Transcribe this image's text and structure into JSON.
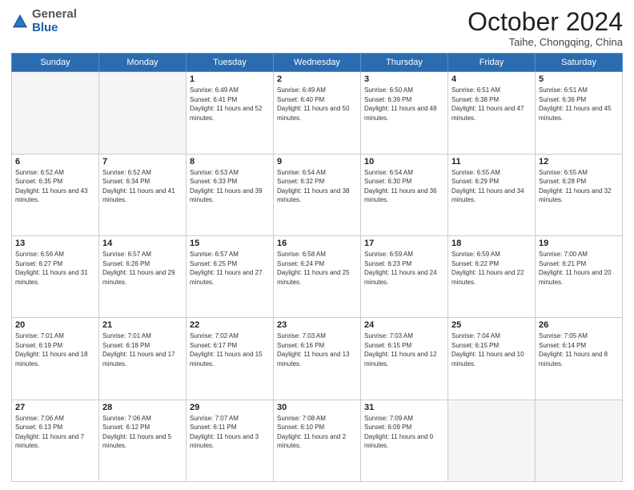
{
  "header": {
    "logo_general": "General",
    "logo_blue": "Blue",
    "month_title": "October 2024",
    "subtitle": "Taihe, Chongqing, China"
  },
  "weekdays": [
    "Sunday",
    "Monday",
    "Tuesday",
    "Wednesday",
    "Thursday",
    "Friday",
    "Saturday"
  ],
  "weeks": [
    [
      {
        "day": "",
        "sunrise": "",
        "sunset": "",
        "daylight": "",
        "empty": true
      },
      {
        "day": "",
        "sunrise": "",
        "sunset": "",
        "daylight": "",
        "empty": true
      },
      {
        "day": "1",
        "sunrise": "Sunrise: 6:49 AM",
        "sunset": "Sunset: 6:41 PM",
        "daylight": "Daylight: 11 hours and 52 minutes.",
        "empty": false
      },
      {
        "day": "2",
        "sunrise": "Sunrise: 6:49 AM",
        "sunset": "Sunset: 6:40 PM",
        "daylight": "Daylight: 11 hours and 50 minutes.",
        "empty": false
      },
      {
        "day": "3",
        "sunrise": "Sunrise: 6:50 AM",
        "sunset": "Sunset: 6:39 PM",
        "daylight": "Daylight: 11 hours and 48 minutes.",
        "empty": false
      },
      {
        "day": "4",
        "sunrise": "Sunrise: 6:51 AM",
        "sunset": "Sunset: 6:38 PM",
        "daylight": "Daylight: 11 hours and 47 minutes.",
        "empty": false
      },
      {
        "day": "5",
        "sunrise": "Sunrise: 6:51 AM",
        "sunset": "Sunset: 6:36 PM",
        "daylight": "Daylight: 11 hours and 45 minutes.",
        "empty": false
      }
    ],
    [
      {
        "day": "6",
        "sunrise": "Sunrise: 6:52 AM",
        "sunset": "Sunset: 6:35 PM",
        "daylight": "Daylight: 11 hours and 43 minutes.",
        "empty": false
      },
      {
        "day": "7",
        "sunrise": "Sunrise: 6:52 AM",
        "sunset": "Sunset: 6:34 PM",
        "daylight": "Daylight: 11 hours and 41 minutes.",
        "empty": false
      },
      {
        "day": "8",
        "sunrise": "Sunrise: 6:53 AM",
        "sunset": "Sunset: 6:33 PM",
        "daylight": "Daylight: 11 hours and 39 minutes.",
        "empty": false
      },
      {
        "day": "9",
        "sunrise": "Sunrise: 6:54 AM",
        "sunset": "Sunset: 6:32 PM",
        "daylight": "Daylight: 11 hours and 38 minutes.",
        "empty": false
      },
      {
        "day": "10",
        "sunrise": "Sunrise: 6:54 AM",
        "sunset": "Sunset: 6:30 PM",
        "daylight": "Daylight: 11 hours and 36 minutes.",
        "empty": false
      },
      {
        "day": "11",
        "sunrise": "Sunrise: 6:55 AM",
        "sunset": "Sunset: 6:29 PM",
        "daylight": "Daylight: 11 hours and 34 minutes.",
        "empty": false
      },
      {
        "day": "12",
        "sunrise": "Sunrise: 6:55 AM",
        "sunset": "Sunset: 6:28 PM",
        "daylight": "Daylight: 11 hours and 32 minutes.",
        "empty": false
      }
    ],
    [
      {
        "day": "13",
        "sunrise": "Sunrise: 6:56 AM",
        "sunset": "Sunset: 6:27 PM",
        "daylight": "Daylight: 11 hours and 31 minutes.",
        "empty": false
      },
      {
        "day": "14",
        "sunrise": "Sunrise: 6:57 AM",
        "sunset": "Sunset: 6:26 PM",
        "daylight": "Daylight: 11 hours and 29 minutes.",
        "empty": false
      },
      {
        "day": "15",
        "sunrise": "Sunrise: 6:57 AM",
        "sunset": "Sunset: 6:25 PM",
        "daylight": "Daylight: 11 hours and 27 minutes.",
        "empty": false
      },
      {
        "day": "16",
        "sunrise": "Sunrise: 6:58 AM",
        "sunset": "Sunset: 6:24 PM",
        "daylight": "Daylight: 11 hours and 25 minutes.",
        "empty": false
      },
      {
        "day": "17",
        "sunrise": "Sunrise: 6:59 AM",
        "sunset": "Sunset: 6:23 PM",
        "daylight": "Daylight: 11 hours and 24 minutes.",
        "empty": false
      },
      {
        "day": "18",
        "sunrise": "Sunrise: 6:59 AM",
        "sunset": "Sunset: 6:22 PM",
        "daylight": "Daylight: 11 hours and 22 minutes.",
        "empty": false
      },
      {
        "day": "19",
        "sunrise": "Sunrise: 7:00 AM",
        "sunset": "Sunset: 6:21 PM",
        "daylight": "Daylight: 11 hours and 20 minutes.",
        "empty": false
      }
    ],
    [
      {
        "day": "20",
        "sunrise": "Sunrise: 7:01 AM",
        "sunset": "Sunset: 6:19 PM",
        "daylight": "Daylight: 11 hours and 18 minutes.",
        "empty": false
      },
      {
        "day": "21",
        "sunrise": "Sunrise: 7:01 AM",
        "sunset": "Sunset: 6:18 PM",
        "daylight": "Daylight: 11 hours and 17 minutes.",
        "empty": false
      },
      {
        "day": "22",
        "sunrise": "Sunrise: 7:02 AM",
        "sunset": "Sunset: 6:17 PM",
        "daylight": "Daylight: 11 hours and 15 minutes.",
        "empty": false
      },
      {
        "day": "23",
        "sunrise": "Sunrise: 7:03 AM",
        "sunset": "Sunset: 6:16 PM",
        "daylight": "Daylight: 11 hours and 13 minutes.",
        "empty": false
      },
      {
        "day": "24",
        "sunrise": "Sunrise: 7:03 AM",
        "sunset": "Sunset: 6:15 PM",
        "daylight": "Daylight: 11 hours and 12 minutes.",
        "empty": false
      },
      {
        "day": "25",
        "sunrise": "Sunrise: 7:04 AM",
        "sunset": "Sunset: 6:15 PM",
        "daylight": "Daylight: 11 hours and 10 minutes.",
        "empty": false
      },
      {
        "day": "26",
        "sunrise": "Sunrise: 7:05 AM",
        "sunset": "Sunset: 6:14 PM",
        "daylight": "Daylight: 11 hours and 8 minutes.",
        "empty": false
      }
    ],
    [
      {
        "day": "27",
        "sunrise": "Sunrise: 7:06 AM",
        "sunset": "Sunset: 6:13 PM",
        "daylight": "Daylight: 11 hours and 7 minutes.",
        "empty": false
      },
      {
        "day": "28",
        "sunrise": "Sunrise: 7:06 AM",
        "sunset": "Sunset: 6:12 PM",
        "daylight": "Daylight: 11 hours and 5 minutes.",
        "empty": false
      },
      {
        "day": "29",
        "sunrise": "Sunrise: 7:07 AM",
        "sunset": "Sunset: 6:11 PM",
        "daylight": "Daylight: 11 hours and 3 minutes.",
        "empty": false
      },
      {
        "day": "30",
        "sunrise": "Sunrise: 7:08 AM",
        "sunset": "Sunset: 6:10 PM",
        "daylight": "Daylight: 11 hours and 2 minutes.",
        "empty": false
      },
      {
        "day": "31",
        "sunrise": "Sunrise: 7:09 AM",
        "sunset": "Sunset: 6:09 PM",
        "daylight": "Daylight: 11 hours and 0 minutes.",
        "empty": false
      },
      {
        "day": "",
        "sunrise": "",
        "sunset": "",
        "daylight": "",
        "empty": true
      },
      {
        "day": "",
        "sunrise": "",
        "sunset": "",
        "daylight": "",
        "empty": true
      }
    ]
  ]
}
